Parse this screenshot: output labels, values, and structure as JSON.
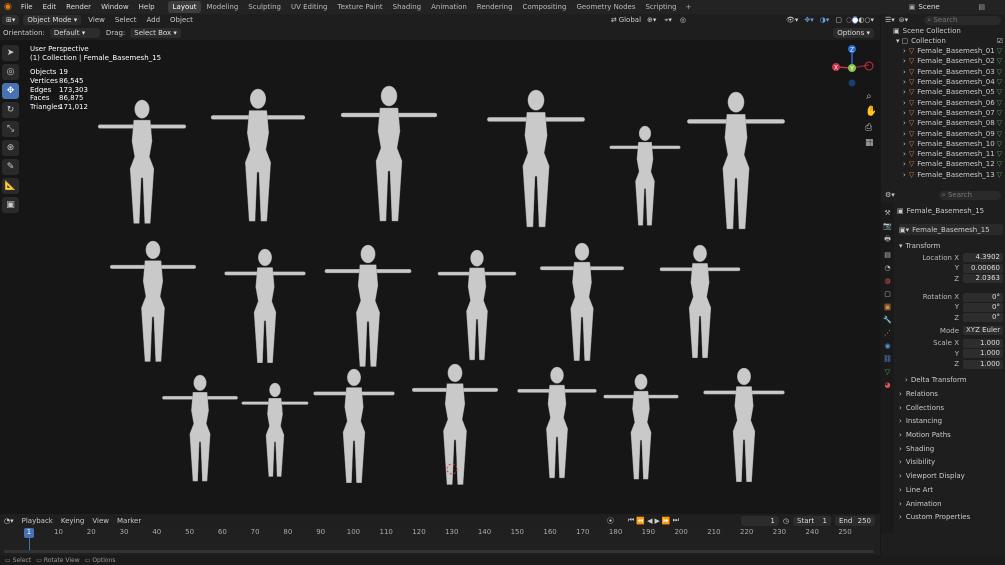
{
  "topbar": {
    "menus": [
      "File",
      "Edit",
      "Render",
      "Window",
      "Help"
    ],
    "workspaces": [
      "Layout",
      "Modeling",
      "Sculpting",
      "UV Editing",
      "Texture Paint",
      "Shading",
      "Animation",
      "Rendering",
      "Compositing",
      "Geometry Nodes",
      "Scripting"
    ],
    "active_workspace": "Layout",
    "add_tab": "+",
    "scene_label": "Scene"
  },
  "viewport_header": {
    "mode": "Object Mode",
    "menus": [
      "View",
      "Select",
      "Add",
      "Object"
    ],
    "transform": "Global"
  },
  "tool_header": {
    "orientation_label": "Orientation:",
    "orientation_value": "Default",
    "drag_label": "Drag:",
    "drag_value": "Select Box",
    "options": "Options"
  },
  "overlay": {
    "perspective": "User Perspective",
    "collection_info": "(1) Collection | Female_Basemesh_15",
    "stats": [
      {
        "label": "Objects",
        "value": "19"
      },
      {
        "label": "Vertices",
        "value": "86,545"
      },
      {
        "label": "Edges",
        "value": "173,303"
      },
      {
        "label": "Faces",
        "value": "86,875"
      },
      {
        "label": "Triangles",
        "value": "171,012"
      }
    ]
  },
  "gizmo": {
    "x": "X",
    "y": "Y",
    "z": "Z"
  },
  "outliner": {
    "search_placeholder": "Search",
    "root": "Scene Collection",
    "collection": "Collection",
    "items": [
      "Female_Basemesh_01",
      "Female_Basemesh_02",
      "Female_Basemesh_03",
      "Female_Basemesh_04",
      "Female_Basemesh_05",
      "Female_Basemesh_06",
      "Female_Basemesh_07",
      "Female_Basemesh_08",
      "Female_Basemesh_09",
      "Female_Basemesh_10",
      "Female_Basemesh_11",
      "Female_Basemesh_12",
      "Female_Basemesh_13"
    ]
  },
  "properties": {
    "search_placeholder": "Search",
    "object_name": "Female_Basemesh_15",
    "datablock_name": "Female_Basemesh_15",
    "transform_title": "Transform",
    "location": {
      "label": "Location X",
      "x": "4.3902",
      "y": "0.00060",
      "z": "2.0363"
    },
    "rotation": {
      "label": "Rotation X",
      "x": "0°",
      "y": "0°",
      "z": "0°"
    },
    "mode": {
      "label": "Mode",
      "value": "XYZ Euler"
    },
    "scale": {
      "label": "Scale X",
      "x": "1.000",
      "y": "1.000",
      "z": "1.000"
    },
    "axis_y": "Y",
    "axis_z": "Z",
    "delta_transform": "Delta Transform",
    "sections": [
      "Relations",
      "Collections",
      "Instancing",
      "Motion Paths",
      "Shading",
      "Visibility",
      "Viewport Display",
      "Line Art",
      "Animation",
      "Custom Properties"
    ]
  },
  "timeline": {
    "menus": [
      "Playback",
      "Keying",
      "View",
      "Marker"
    ],
    "current_frame": "1",
    "start_label": "Start",
    "start": "1",
    "end_label": "End",
    "end": "250",
    "ticks": [
      "1",
      "10",
      "20",
      "30",
      "40",
      "50",
      "60",
      "70",
      "80",
      "90",
      "100",
      "110",
      "120",
      "130",
      "140",
      "150",
      "160",
      "170",
      "180",
      "190",
      "200",
      "210",
      "220",
      "230",
      "240",
      "250"
    ]
  },
  "statusbar": {
    "items": [
      "Select",
      "Rotate View",
      "Options"
    ]
  }
}
